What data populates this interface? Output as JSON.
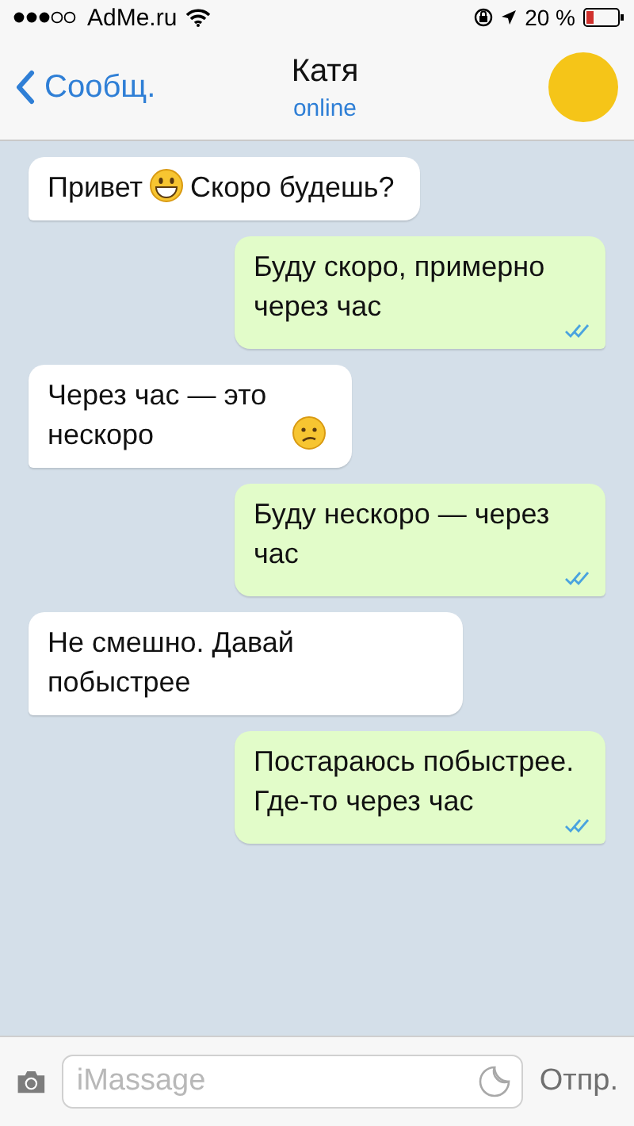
{
  "status_bar": {
    "carrier": "AdMe.ru",
    "battery_text": "20 %"
  },
  "header": {
    "back_label": "Сообщ.",
    "title": "Катя",
    "subtitle": "online"
  },
  "messages": [
    {
      "kind": "incoming",
      "parts": [
        {
          "kind": "text",
          "text": "Привет"
        },
        {
          "kind": "grin"
        },
        {
          "kind": "text",
          "text": "Скоро будешь?"
        }
      ]
    },
    {
      "kind": "outgoing",
      "read": true,
      "parts": [
        {
          "kind": "text",
          "text": "Буду скоро, примерно через час"
        }
      ]
    },
    {
      "kind": "incoming",
      "parts": [
        {
          "kind": "text",
          "text": "Через час — это нескоро"
        },
        {
          "kind": "confused"
        }
      ]
    },
    {
      "kind": "outgoing",
      "read": true,
      "parts": [
        {
          "kind": "text",
          "text": "Буду нескоро — через час"
        }
      ]
    },
    {
      "kind": "incoming",
      "parts": [
        {
          "kind": "text",
          "text": "Не смешно. Давай побыстрее"
        }
      ]
    },
    {
      "kind": "outgoing",
      "read": true,
      "parts": [
        {
          "kind": "text",
          "text": "Постараюсь побыстрее. Где-то через час"
        }
      ]
    }
  ],
  "composer": {
    "placeholder": "iMassage",
    "send_label": "Отпр."
  }
}
